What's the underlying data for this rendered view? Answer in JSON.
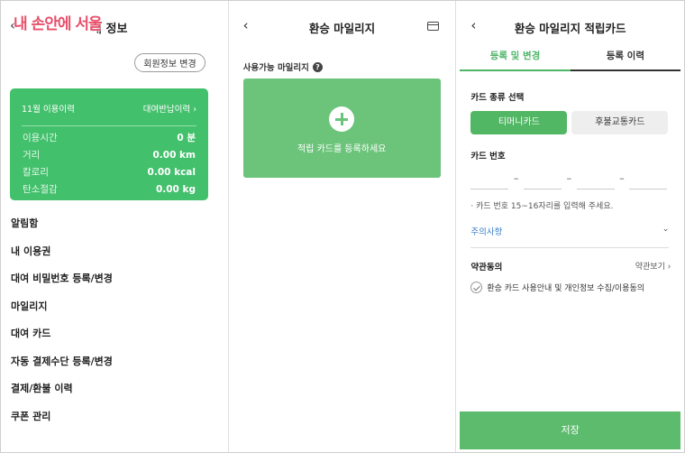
{
  "panel1": {
    "watermark": "내 손안에 서울",
    "title": "내 정보",
    "member_edit": "회원정보 변경",
    "usage": {
      "month_label": "11월 이용이력",
      "history_link": "대여반납이력",
      "rows": [
        {
          "label": "이용시간",
          "value": "0 분"
        },
        {
          "label": "거리",
          "value": "0.00 km"
        },
        {
          "label": "칼로리",
          "value": "0.00 kcal"
        },
        {
          "label": "탄소절감",
          "value": "0.00 kg"
        }
      ]
    },
    "menu": [
      "알림함",
      "내 이용권",
      "대여 비밀번호 등록/변경",
      "마일리지",
      "대여 카드",
      "자동 결제수단 등록/변경",
      "결제/환불 이력",
      "쿠폰 관리"
    ]
  },
  "panel2": {
    "title": "환승 마일리지",
    "available_label": "사용가능 마일리지",
    "register_text": "적립 카드를 등록하세요"
  },
  "panel3": {
    "title": "환승 마일리지 적립카드",
    "tabs": [
      "등록 및 변경",
      "등록 이력"
    ],
    "card_type_label": "카드 종류 선택",
    "card_types": [
      "티머니카드",
      "후불교통카드"
    ],
    "card_number_label": "카드 번호",
    "dash": "–",
    "hint": "· 카드 번호 15~16자리를 입력해 주세요.",
    "notice": "주의사항",
    "agree_title": "약관동의",
    "terms_link": "약관보기",
    "agree_text": "환승 카드 사용안내 및 개인정보 수집/이용동의",
    "save": "저장"
  },
  "colors": {
    "accent": "#43c06c",
    "watermark": "#e8506b",
    "link": "#3b7ec7"
  }
}
